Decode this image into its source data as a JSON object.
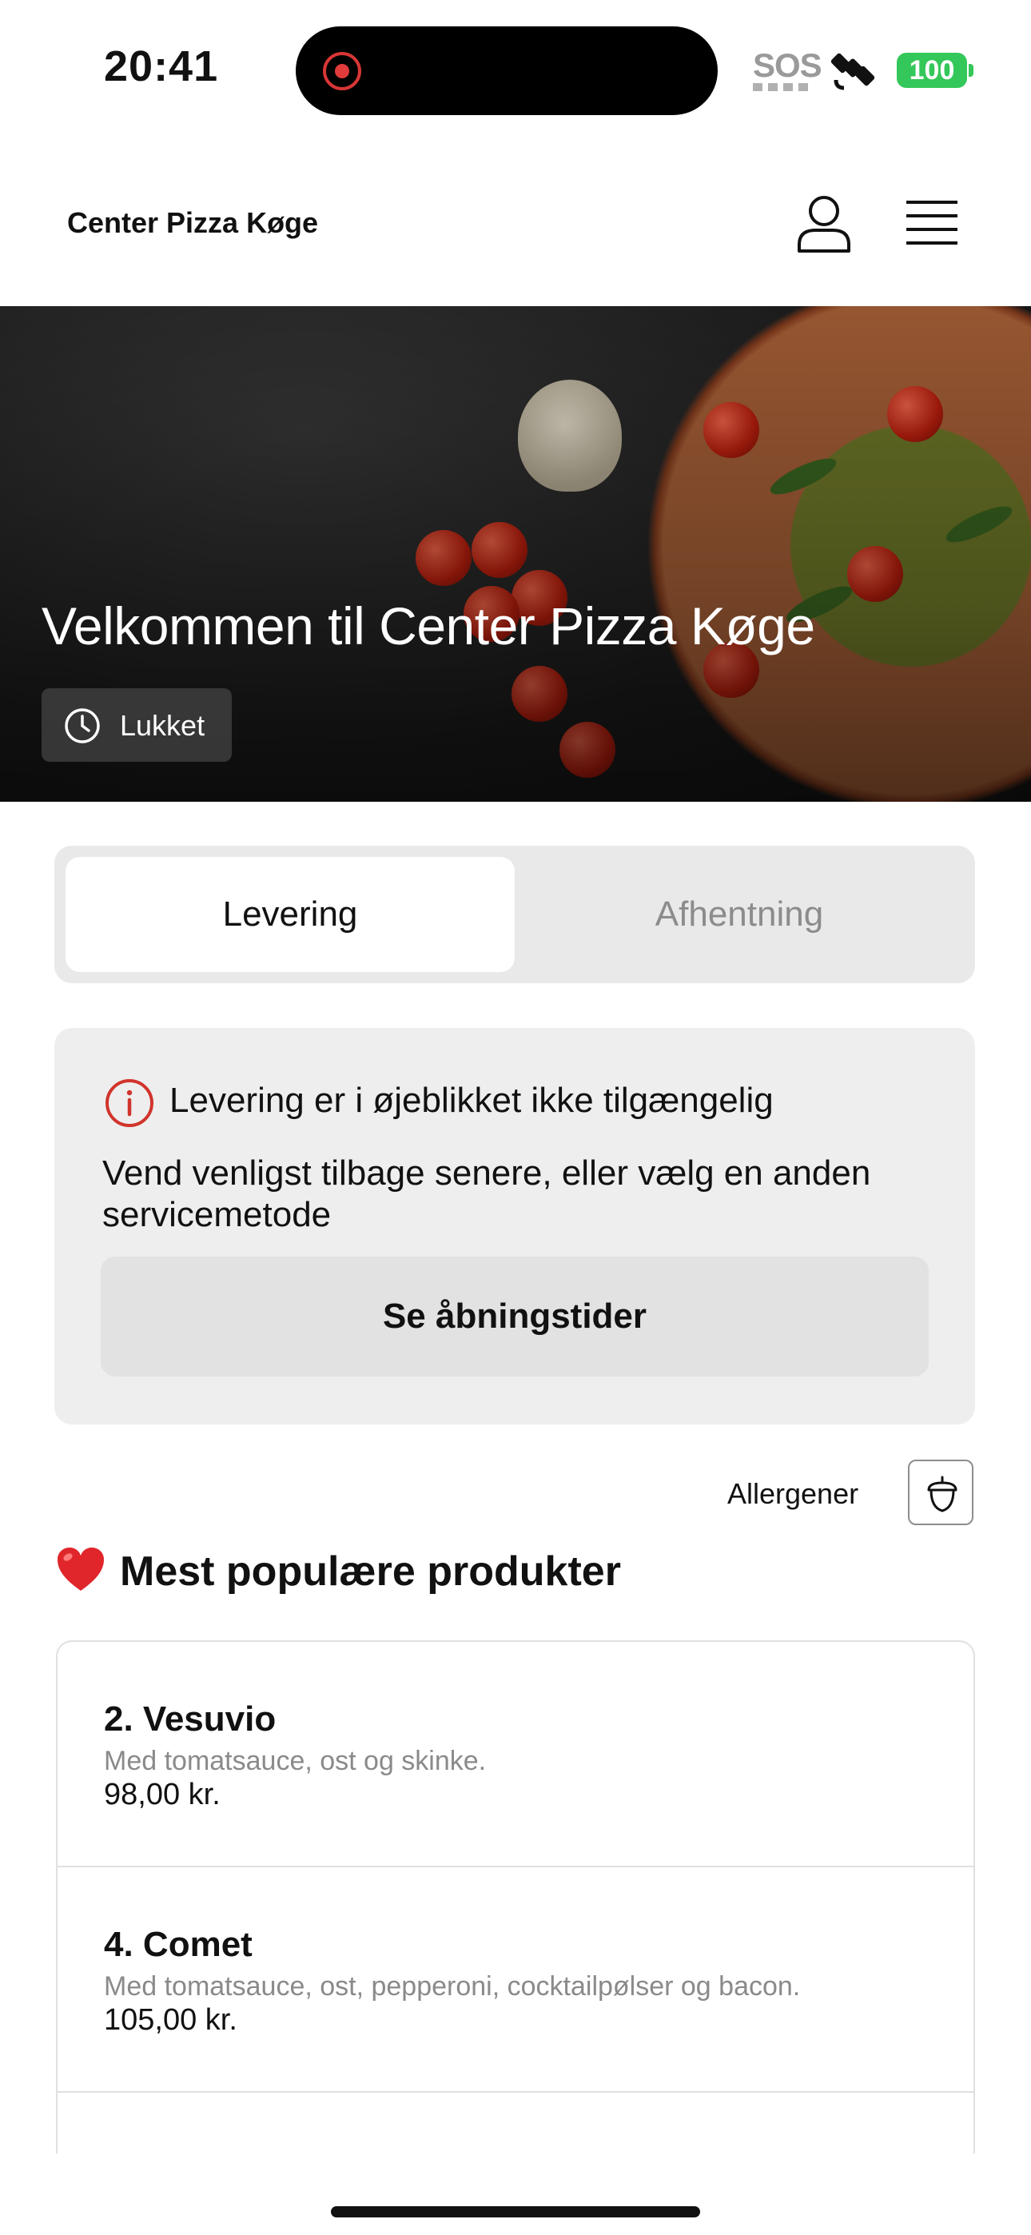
{
  "status_bar": {
    "time": "20:41",
    "sos": "SOS",
    "battery": "100",
    "colors": {
      "battery": "#34c759",
      "recording": "#e23b3b"
    }
  },
  "header": {
    "brand": "Center Pizza Køge",
    "icons": [
      "user-icon",
      "menu-icon"
    ]
  },
  "hero": {
    "title": "Velkommen til Center Pizza Køge",
    "status": "Lukket"
  },
  "tabs": [
    {
      "label": "Levering",
      "active": true
    },
    {
      "label": "Afhentning",
      "active": false
    }
  ],
  "notice": {
    "title": "Levering er i øjeblikket ikke tilgængelig",
    "body": "Vend venligst tilbage senere, eller vælg en anden servicemetode",
    "button": "Se åbningstider",
    "accent": "#d0342c"
  },
  "allergens": {
    "label": "Allergener"
  },
  "popular": {
    "title": "Mest populære produkter",
    "products": [
      {
        "name": "2. Vesuvio",
        "description": "Med tomatsauce, ost og skinke.",
        "price": "98,00 kr."
      },
      {
        "name": "4. Comet",
        "description": "Med tomatsauce, ost, pepperoni, cocktailpølser og bacon.",
        "price": "105,00 kr."
      }
    ]
  }
}
